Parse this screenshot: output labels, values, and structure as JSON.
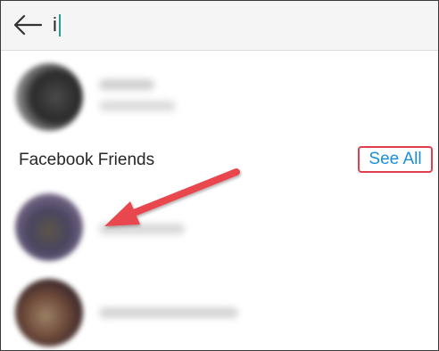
{
  "search": {
    "value": "i",
    "back_icon": "arrow-left-icon"
  },
  "results": {
    "section_title": "Facebook Friends",
    "see_all_label": "See All"
  },
  "colors": {
    "accent_blue": "#1a8fd6",
    "highlight_red": "#e0404d",
    "caret_teal": "#2a9e96"
  },
  "annotation": {
    "arrow_icon": "red-arrow-annotation"
  }
}
